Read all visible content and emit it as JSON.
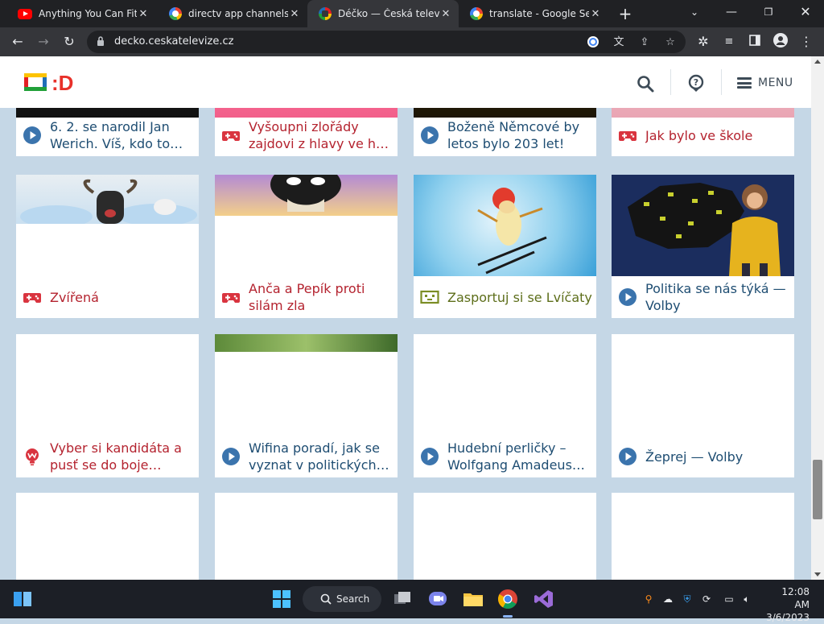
{
  "browser": {
    "tabs": [
      {
        "title": "Anything You Can Fit In",
        "icon": "youtube-icon",
        "active": false
      },
      {
        "title": "directv app channels -",
        "icon": "google-icon",
        "active": false
      },
      {
        "title": "Déčko — Česká televize",
        "icon": "ceska-televize-icon",
        "active": true
      },
      {
        "title": "translate - Google Sear",
        "icon": "google-icon",
        "active": false
      }
    ],
    "url": "decko.ceskatelevize.cz"
  },
  "site": {
    "logo_text": ":D",
    "menu_label": "MENU"
  },
  "cards": [
    {
      "title": "6. 2. se narodil Jan Werich. Víš, kdo to…",
      "type": "video"
    },
    {
      "title": "Vyšoupni zlořády zajdovi z hlavy ve h…",
      "type": "game"
    },
    {
      "title": "Boženě Němcové by letos bylo 203 let!",
      "type": "video"
    },
    {
      "title": "Jak bylo ve škole",
      "type": "game"
    },
    {
      "title": "Zvířená",
      "type": "game"
    },
    {
      "title": "Anča a Pepík proti silám zla",
      "type": "game"
    },
    {
      "title": "Zasportuj si se Lvíčaty",
      "type": "activity"
    },
    {
      "title": "Politika se nás týká — Volby",
      "type": "video"
    },
    {
      "title": "Vyber si kandidáta a pusť se do boje…",
      "type": "quiz"
    },
    {
      "title": "Wifina poradí, jak se vyznat v politických…",
      "type": "video"
    },
    {
      "title": "Hudební perličky – Wolfgang Amadeus…",
      "type": "video"
    },
    {
      "title": "Žeprej — Volby",
      "type": "video"
    }
  ],
  "taskbar": {
    "search_label": "Search",
    "time": "12:08 AM",
    "date": "3/6/2023"
  },
  "colors": {
    "page_bg": "#c5d7e6",
    "video_blue": "#1e4d72",
    "game_red": "#b4232f",
    "activity_olive": "#5d6e1a"
  }
}
